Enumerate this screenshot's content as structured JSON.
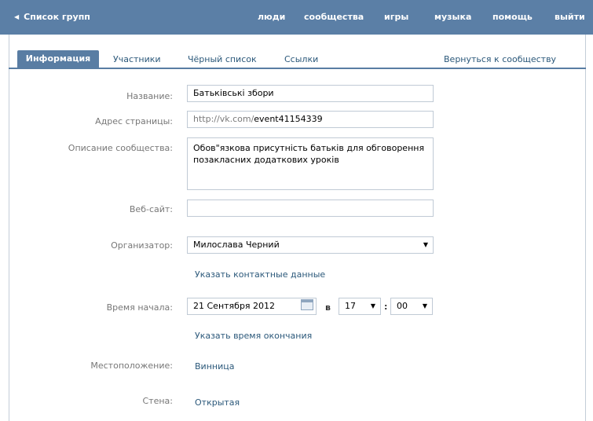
{
  "topbar": {
    "back_label": "Список групп",
    "nav": [
      "люди",
      "сообщества",
      "игры",
      "музыка",
      "помощь",
      "выйти"
    ]
  },
  "tabs": {
    "info": "Информация",
    "members": "Участники",
    "blacklist": "Чёрный список",
    "links": "Ссылки",
    "return": "Вернуться к сообществу"
  },
  "form": {
    "name_label": "Название:",
    "name_value": "Батьківські збори",
    "address_label": "Адрес страницы:",
    "address_prefix": "http://vk.com/",
    "address_value": "event41154339",
    "description_label": "Описание сообщества:",
    "description_value": "Обов\"язкова присутність батьків для обговорення позакласних додаткових уроків",
    "website_label": "Веб-сайт:",
    "website_value": "",
    "organizer_label": "Организатор:",
    "organizer_value": "Милослава Черний",
    "contact_link": "Указать контактные данные",
    "start_label": "Время начала:",
    "start_date": "21 Сентября 2012",
    "at_label": "в",
    "start_hour": "17",
    "colon": ":",
    "start_minute": "00",
    "end_time_link": "Указать время окончания",
    "location_label": "Местоположение:",
    "location_value": "Винница",
    "wall_label": "Стена:",
    "wall_value": "Открытая"
  }
}
